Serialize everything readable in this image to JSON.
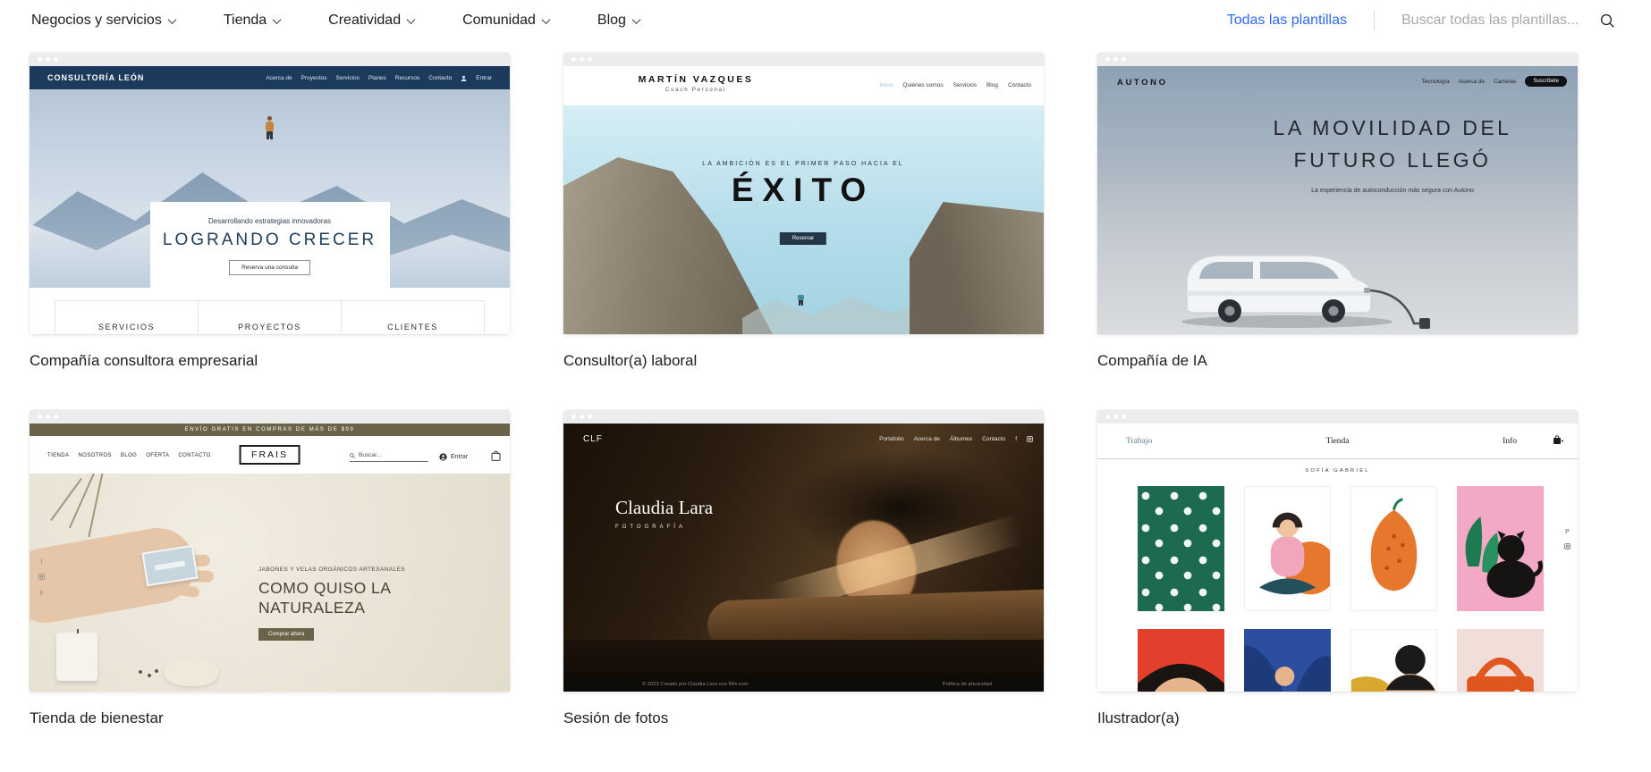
{
  "topnav": {
    "menus": [
      "Negocios y servicios",
      "Tienda",
      "Creatividad",
      "Comunidad",
      "Blog"
    ],
    "all_templates": "Todas las plantillas",
    "search_placeholder": "Buscar todas las plantillas..."
  },
  "colors": {
    "accent_blue": "#2f6af0",
    "card1_navy": "#1b3a5c",
    "card4_olive": "#6b6349",
    "tile_green": "#1c6b4e",
    "tile_orange": "#e8772e",
    "tile_pink": "#f3a9c6",
    "tile_red": "#e2402c",
    "tile_blue": "#2b4f9e",
    "tile_mustard": "#d9a92f"
  },
  "icons": {
    "search": "magnifier",
    "chevron": "chevron-down",
    "user": "person-silhouette",
    "bag": "shopping-bag",
    "cart": "shopping-cart",
    "facebook": "f",
    "instagram": "camera-square",
    "pinterest": "p"
  },
  "cards": [
    {
      "title": "Compañía consultora empresarial",
      "site": {
        "brand": "CONSULTORÍA LEÓN",
        "nav": [
          "Acerca de",
          "Proyectos",
          "Servicios",
          "Planes",
          "Recursos",
          "Contacto"
        ],
        "login": "Entrar",
        "tagline": "Desarrollando estrategias innovadoras",
        "headline": "LOGRANDO CRECER",
        "cta": "Reserva una consulta",
        "columns": [
          "SERVICIOS",
          "PROYECTOS",
          "CLIENTES"
        ]
      }
    },
    {
      "title": "Consultor(a) laboral",
      "site": {
        "brand": "MARTÍN VAZQUES",
        "brand_sub": "Coach Personal",
        "nav": [
          "Inicio",
          "Quiénes somos",
          "Servicios",
          "Blog",
          "Contacto"
        ],
        "kicker": "LA AMBICIÓN ES EL PRIMER PASO HACIA EL",
        "headline": "ÉXITO",
        "cta": "Reservar"
      }
    },
    {
      "title": "Compañía de IA",
      "site": {
        "brand": "AUTONO",
        "nav": [
          "Tecnología",
          "Acerca de",
          "Carreras"
        ],
        "cta": "Suscríbete",
        "headline_line1": "LA MOVILIDAD DEL",
        "headline_line2": "FUTURO LLEGÓ",
        "subheadline": "La experiencia de autoconducción más segura con Autono"
      }
    },
    {
      "title": "Tienda de bienestar",
      "site": {
        "banner": "ENVÍO GRATIS EN COMPRAS DE MÁS DE $99",
        "nav": [
          "TIENDA",
          "NOSOTROS",
          "BLOG",
          "OFERTA",
          "CONTACTO"
        ],
        "brand": "FRAIS",
        "search": "Buscar...",
        "login": "Entrar",
        "kicker": "JABONES Y VELAS ORGÁNICOS ARTESANALES",
        "headline_line1": "COMO QUISO LA",
        "headline_line2": "NATURALEZA",
        "cta": "Comprar ahora"
      }
    },
    {
      "title": "Sesión de fotos",
      "site": {
        "brand": "CLF",
        "nav": [
          "Portafolio",
          "Acerca de",
          "Álbumes",
          "Contacto"
        ],
        "name": "Claudia Lara",
        "name_sub": "FOTOGRAFÍA",
        "footer_left": "© 2023 Creado por Claudia Lara con Wix.com",
        "footer_right": "Política de privacidad"
      }
    },
    {
      "title": "Ilustrador(a)",
      "site": {
        "nav": [
          "Trabajo",
          "Tienda",
          "Info"
        ],
        "brand": "SOFÍA GABRIEL"
      }
    }
  ]
}
